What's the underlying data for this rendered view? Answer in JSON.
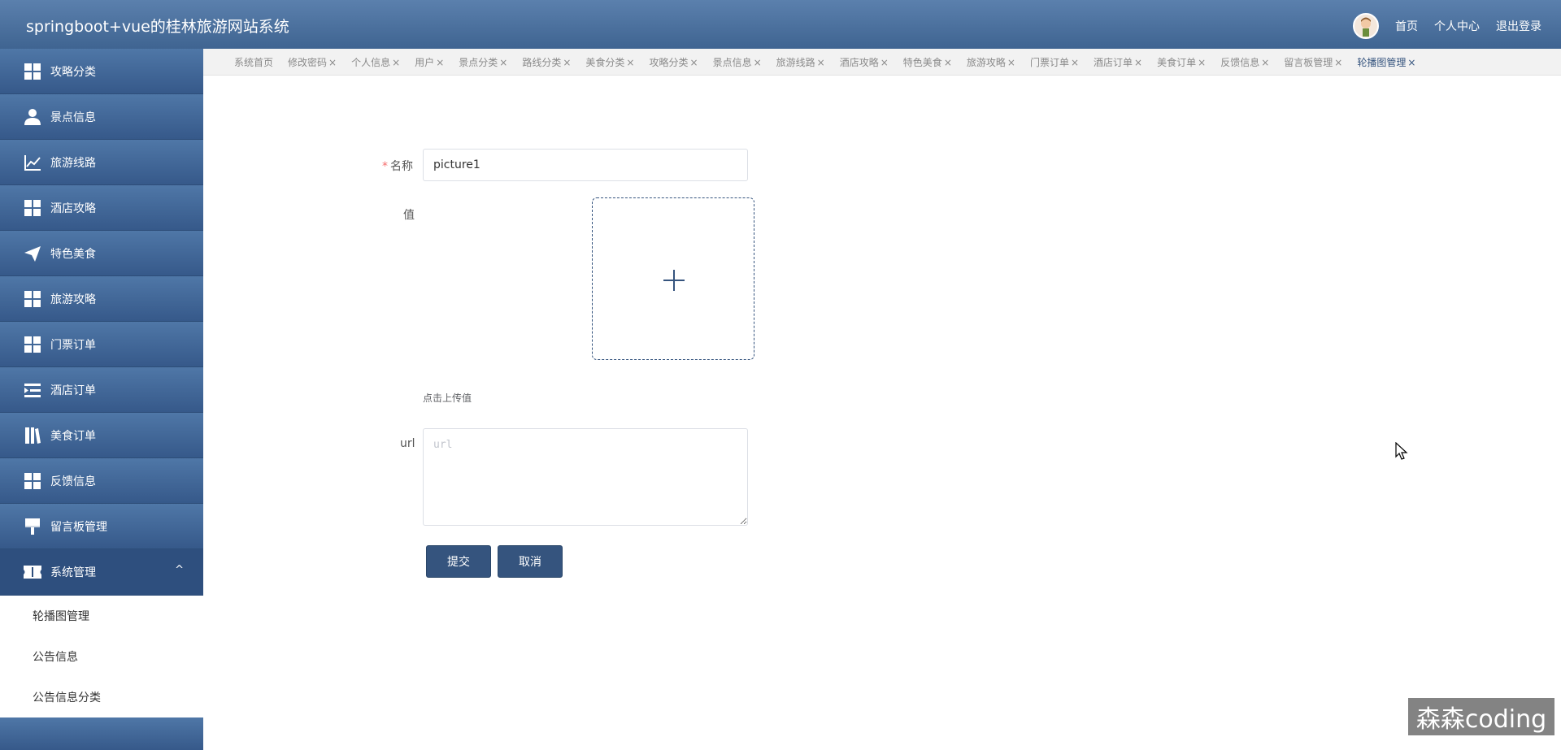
{
  "header": {
    "title": "springboot+vue的桂林旅游网站系统",
    "links": [
      "首页",
      "个人中心",
      "退出登录"
    ]
  },
  "sidebar": {
    "items": [
      {
        "label": "攻略分类",
        "icon": "grid-icon"
      },
      {
        "label": "景点信息",
        "icon": "user-icon"
      },
      {
        "label": "旅游线路",
        "icon": "chart-line-icon"
      },
      {
        "label": "酒店攻略",
        "icon": "grid-icon"
      },
      {
        "label": "特色美食",
        "icon": "paper-plane-icon"
      },
      {
        "label": "旅游攻略",
        "icon": "grid-icon"
      },
      {
        "label": "门票订单",
        "icon": "grid-icon"
      },
      {
        "label": "酒店订单",
        "icon": "list-indent-icon"
      },
      {
        "label": "美食订单",
        "icon": "book-icon"
      },
      {
        "label": "反馈信息",
        "icon": "grid-icon"
      },
      {
        "label": "留言板管理",
        "icon": "brush-icon"
      }
    ],
    "open_group": {
      "label": "系统管理",
      "icon": "ticket-icon",
      "chevron": "^"
    },
    "sub_items": [
      "轮播图管理",
      "公告信息",
      "公告信息分类"
    ]
  },
  "tabs": {
    "items": [
      "系统首页",
      "修改密码",
      "个人信息",
      "用户",
      "景点分类",
      "路线分类",
      "美食分类",
      "攻略分类",
      "景点信息",
      "旅游线路",
      "酒店攻略",
      "特色美食",
      "旅游攻略",
      "门票订单",
      "酒店订单",
      "美食订单",
      "反馈信息",
      "留言板管理",
      "轮播图管理"
    ],
    "close_glyph": "×",
    "active": "轮播图管理"
  },
  "form": {
    "name_label": "名称",
    "required_mark": "*",
    "name_value": "picture1",
    "value_label": "值",
    "upload_hint": "点击上传值",
    "url_label": "url",
    "url_placeholder": "url",
    "submit_label": "提交",
    "cancel_label": "取消"
  },
  "watermark": "森森coding",
  "colors": {
    "primary": "#35547e",
    "header": "#4a6f9c",
    "required": "#f56c6c"
  }
}
